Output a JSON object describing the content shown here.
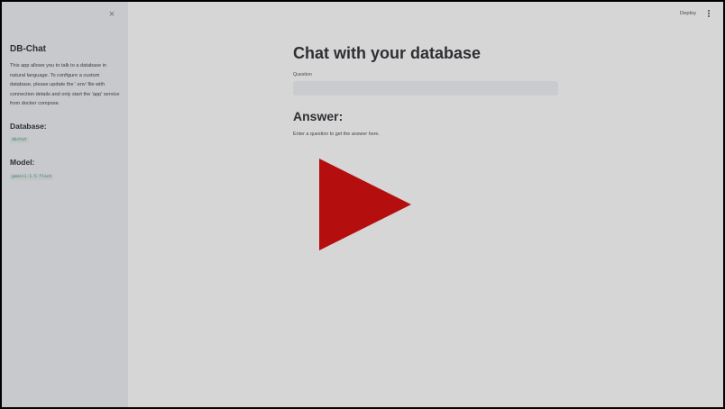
{
  "sidebar": {
    "close_icon": "close-icon",
    "close_glyph": "×",
    "title": "DB-Chat",
    "description": "This app allows you to talk to a database in natural language. To configure a custom database, please update the '.env' file with connection details and only start the 'app' service from docker compose.",
    "database_heading": "Database:",
    "database_value": "dbchat",
    "model_heading": "Model:",
    "model_value": "gemini-1.5-flash"
  },
  "header": {
    "deploy_label": "Deploy",
    "menu_icon": "vertical-ellipsis-icon"
  },
  "main": {
    "title": "Chat with your database",
    "question_label": "Question",
    "question_value": "",
    "answer_heading": "Answer:",
    "answer_text": "Enter a question to get the answer here."
  },
  "overlay": {
    "icon": "play-icon",
    "color": "#b50e0e"
  },
  "colors": {
    "sidebar_bg": "#c8c9cc",
    "main_bg": "#d6d6d6",
    "code_text": "#2f8a4f"
  }
}
